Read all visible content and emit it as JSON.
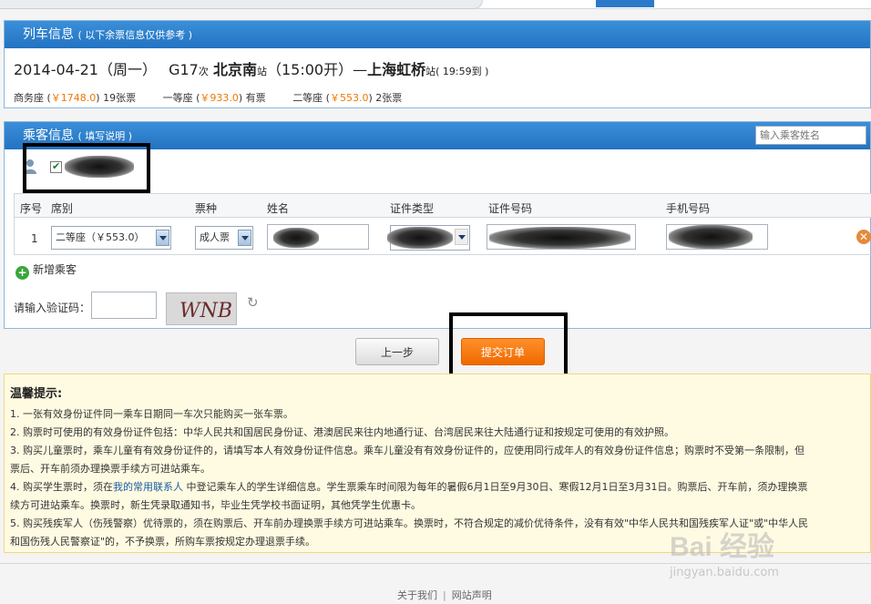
{
  "train": {
    "header_title": "列车信息",
    "header_note": "( 以下余票信息仅供参考 )",
    "date": "2014-04-21",
    "weekday": "（周一）",
    "train_no": "G17",
    "train_suffix": "次",
    "from_station": "北京南",
    "station_suffix": "站",
    "depart": "（15:00开）",
    "dash": "—",
    "to_station": "上海虹桥",
    "arrive": "( 19:59到 )",
    "seats": [
      {
        "label": "商务座 (",
        "price": "￥1748.0",
        "after": ") 19张票"
      },
      {
        "label": "一等座 (",
        "price": "￥933.0",
        "after": ") 有票"
      },
      {
        "label": "二等座 (",
        "price": "￥553.0",
        "after": ") 2张票"
      }
    ]
  },
  "passenger": {
    "header_title": "乘客信息",
    "header_note": "( 填写说明 )",
    "search_placeholder": "输入乘客姓名",
    "table_headers": [
      "序号",
      "席别",
      "票种",
      "姓名",
      "证件类型",
      "证件号码",
      "手机号码"
    ],
    "row": {
      "index": "1",
      "seat": "二等座（￥553.0）",
      "ticket_type": "成人票"
    },
    "add_label": "新增乘客",
    "captcha_label": "请输入验证码：",
    "captcha_text": "WNB"
  },
  "actions": {
    "prev_label": "上一步",
    "submit_label": "提交订单"
  },
  "notice": {
    "title": "温馨提示:",
    "items": [
      "1. 一张有效身份证件同一乘车日期同一车次只能购买一张车票。",
      "2. 购票时可使用的有效身份证件包括：中华人民共和国居民身份证、港澳居民来往内地通行证、台湾居民来往大陆通行证和按规定可使用的有效护照。",
      "3. 购买儿童票时，乘车儿童有有效身份证件的，请填写本人有效身份证件信息。乘车儿童没有有效身份证件的，应使用同行成年人的有效身份证件信息；购票时不受第一条限制，但",
      "票后、开车前须办理换票手续方可进站乘车。"
    ],
    "item4_pre": "4. 购买学生票时，须在",
    "item4_link": "我的常用联系人",
    "item4_post": " 中登记乘车人的学生详细信息。学生票乘车时间限为每年的暑假6月1日至9月30日、寒假12月1日至3月31日。购票后、开车前，须办理换票",
    "item4_cont": "续方可进站乘车。换票时，新生凭录取通知书，毕业生凭学校书面证明，其他凭学生优惠卡。",
    "item5": "5. 购买残疾军人（伤残警察）优待票的，须在购票后、开车前办理换票手续方可进站乘车。换票时，不符合规定的减价优待条件，没有有效\"中华人民共和国残疾军人证\"或\"中华人民",
    "item5_cont": "和国伤残人民警察证\"的，不予换票，所购车票按规定办理退票手续。"
  },
  "footer": {
    "about": "关于我们",
    "statement": "网站声明"
  },
  "watermark": {
    "brand": "Bai 经验",
    "url": "jingyan.baidu.com"
  }
}
